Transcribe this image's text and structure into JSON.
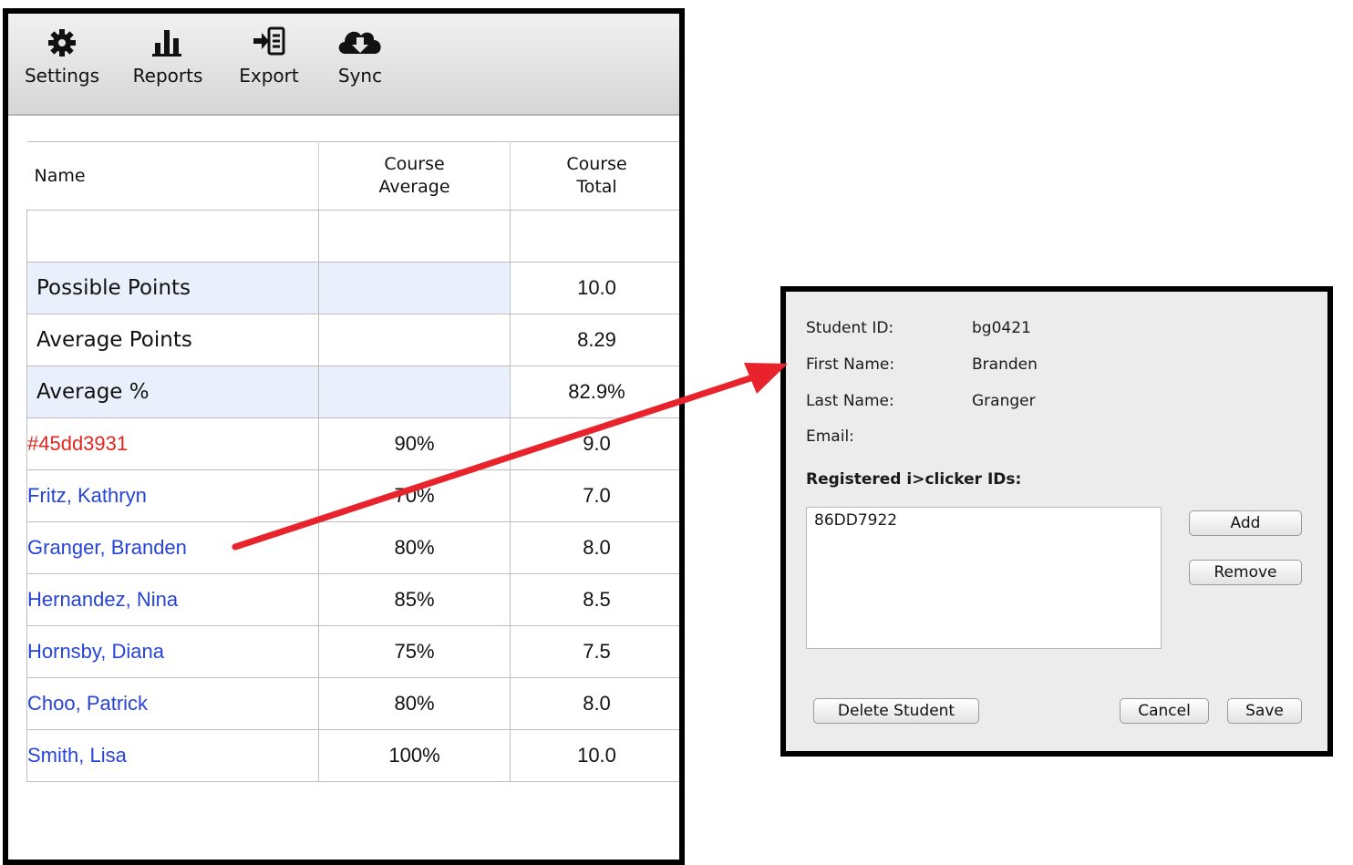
{
  "toolbar": {
    "items": [
      {
        "label": "Settings",
        "icon": "gear-icon"
      },
      {
        "label": "Reports",
        "icon": "bar-chart-icon"
      },
      {
        "label": "Export",
        "icon": "export-icon"
      },
      {
        "label": "Sync",
        "icon": "cloud-download-icon"
      }
    ]
  },
  "grid": {
    "headers": {
      "name": "Name",
      "avg_line1": "Course",
      "avg_line2": "Average",
      "tot_line1": "Course",
      "tot_line2": "Total"
    },
    "summary": [
      {
        "label": "Possible Points",
        "avg": "",
        "total": "10.0"
      },
      {
        "label": "Average Points",
        "avg": "",
        "total": "8.29"
      },
      {
        "label": "Average %",
        "avg": "",
        "total": "82.9%"
      }
    ],
    "students": [
      {
        "name": "#45dd3931",
        "avg": "90%",
        "total": "9.0",
        "unregistered": true
      },
      {
        "name": "Fritz, Kathryn",
        "avg": "70%",
        "total": "7.0"
      },
      {
        "name": "Granger, Branden",
        "avg": "80%",
        "total": "8.0"
      },
      {
        "name": "Hernandez, Nina",
        "avg": "85%",
        "total": "8.5"
      },
      {
        "name": "Hornsby, Diana",
        "avg": "75%",
        "total": "7.5"
      },
      {
        "name": "Choo, Patrick",
        "avg": "80%",
        "total": "8.0"
      },
      {
        "name": "Smith, Lisa",
        "avg": "100%",
        "total": "10.0"
      }
    ]
  },
  "dialog": {
    "student_id_label": "Student ID:",
    "student_id": "bg0421",
    "first_name_label": "First Name:",
    "first_name": "Branden",
    "last_name_label": "Last Name:",
    "last_name": "Granger",
    "email_label": "Email:",
    "email": "",
    "registered_title": "Registered i>clicker IDs:",
    "clicker_ids": [
      "86DD7922"
    ],
    "add_label": "Add",
    "remove_label": "Remove",
    "delete_label": "Delete Student",
    "cancel_label": "Cancel",
    "save_label": "Save"
  },
  "colors": {
    "student_link": "#2743d9",
    "unregistered": "#e3261f",
    "arrow": "#e8232b",
    "summary_shade": "#eaf0fb"
  }
}
